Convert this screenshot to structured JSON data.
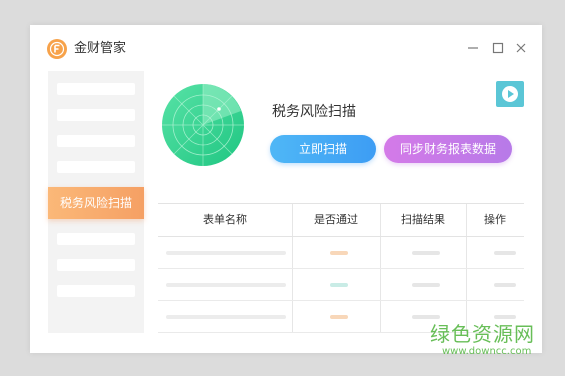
{
  "app": {
    "title": "金财管家"
  },
  "window_controls": {
    "minimize": "minimize-icon",
    "maximize": "maximize-icon",
    "close": "close-icon"
  },
  "sidebar": {
    "items": [
      {
        "label": ""
      },
      {
        "label": ""
      },
      {
        "label": ""
      },
      {
        "label": ""
      },
      {
        "label": "税务风险扫描",
        "active": true
      },
      {
        "label": ""
      },
      {
        "label": ""
      },
      {
        "label": ""
      }
    ],
    "active_label": "税务风险扫描"
  },
  "main": {
    "title": "税务风险扫描",
    "scan_button": "立即扫描",
    "sync_button": "同步财务报表数据",
    "video_icon": "play-icon"
  },
  "table": {
    "headers": [
      "表单名称",
      "是否通过",
      "扫描结果",
      "操作"
    ],
    "rows": [
      {
        "status_color": "#f8d7b9"
      },
      {
        "status_color": "#c9ece6"
      },
      {
        "status_color": "#f8d7b9"
      }
    ]
  },
  "colors": {
    "accent_orange": "#f5a064",
    "scan_blue": "#3d9df4",
    "sync_purple": "#c67ae8",
    "radar_green": "#29d38f"
  },
  "watermark": {
    "name": "绿色资源网",
    "url": "www.downcc.com"
  }
}
